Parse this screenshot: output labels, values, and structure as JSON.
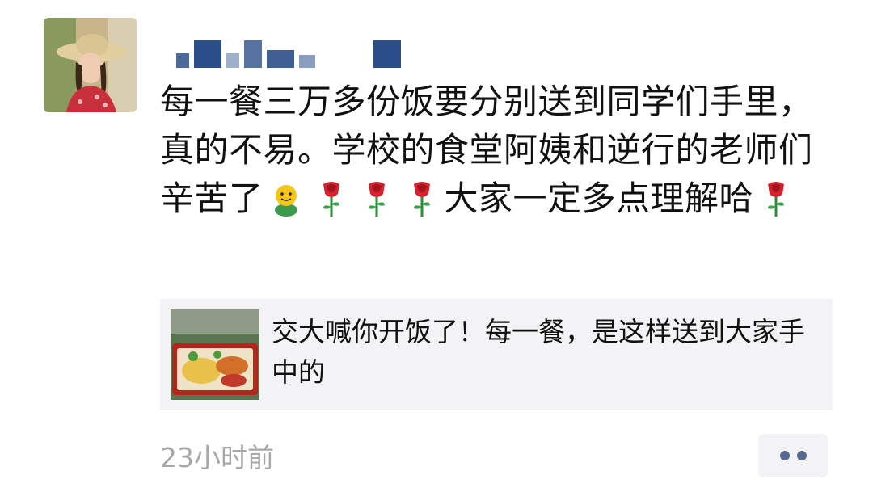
{
  "post": {
    "author_avatar": "avatar-photo",
    "author_name": "",
    "text_before_emoji": "每一餐三万多份饭要分别送到同学们手里，真的不易。学校的食堂阿姨和逆行的老师们辛苦了",
    "text_middle": "大家一定多点理解哈",
    "emojis": [
      "smile-icon",
      "rose-icon"
    ]
  },
  "link_card": {
    "title": "交大喊你开饭了！每一餐，是这样送到大家手中的",
    "thumbnail": "food-box-photo"
  },
  "meta": {
    "timestamp": "23小时前",
    "more_icon": "more-icon"
  },
  "colors": {
    "link_bg": "#f3f3f5",
    "timestamp": "#a8a8a8",
    "more_dots": "#57698f"
  }
}
